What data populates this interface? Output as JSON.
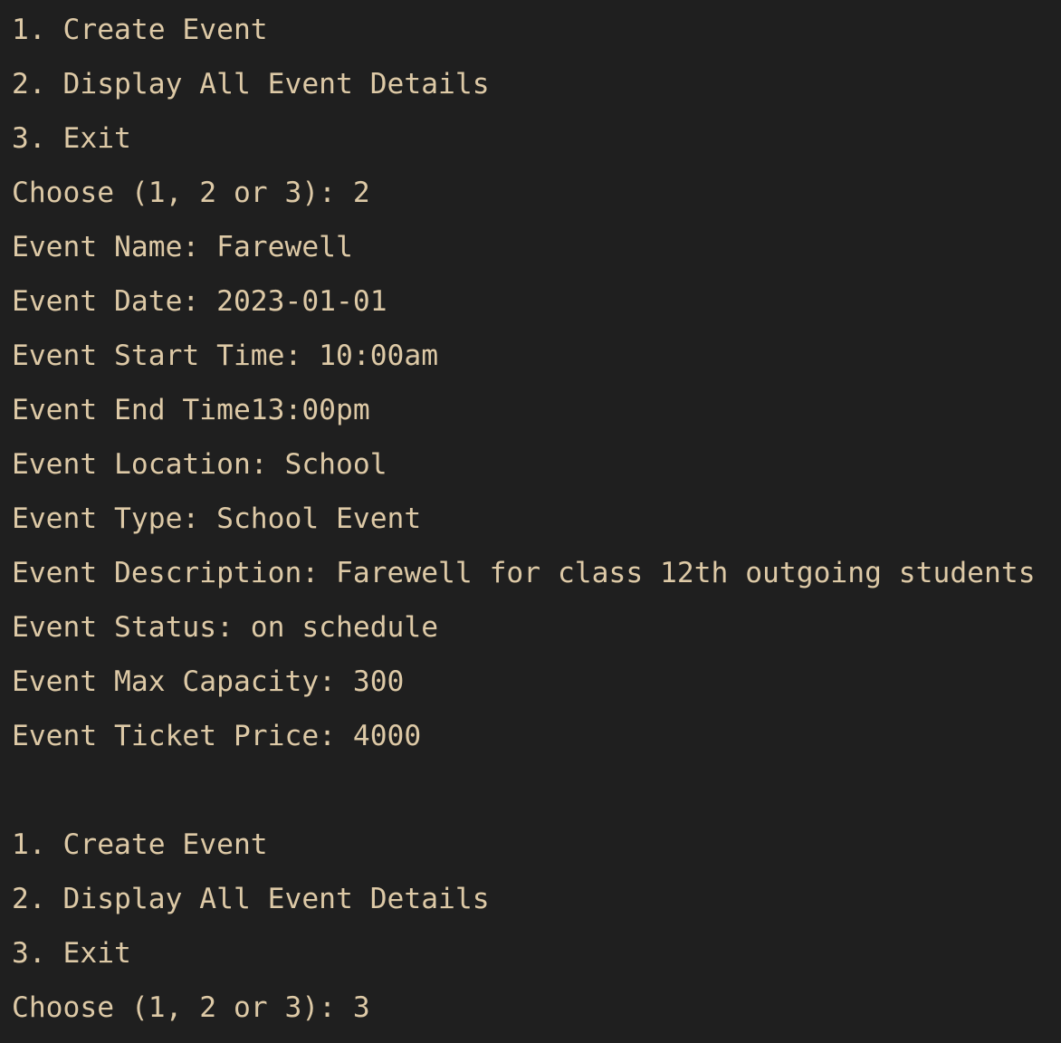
{
  "terminal": {
    "colors": {
      "background": "#1f1f1f",
      "text": "#ddc9a6"
    },
    "lines": [
      "1. Create Event",
      "2. Display All Event Details",
      "3. Exit",
      "Choose (1, 2 or 3): 2",
      "Event Name: Farewell",
      "Event Date: 2023-01-01",
      "Event Start Time: 10:00am",
      "Event End Time13:00pm",
      "Event Location: School",
      "Event Type: School Event",
      "Event Description: Farewell for class 12th outgoing students",
      "Event Status: on schedule",
      "Event Max Capacity: 300",
      "Event Ticket Price: 4000",
      "",
      "1. Create Event",
      "2. Display All Event Details",
      "3. Exit",
      "Choose (1, 2 or 3): 3"
    ]
  }
}
